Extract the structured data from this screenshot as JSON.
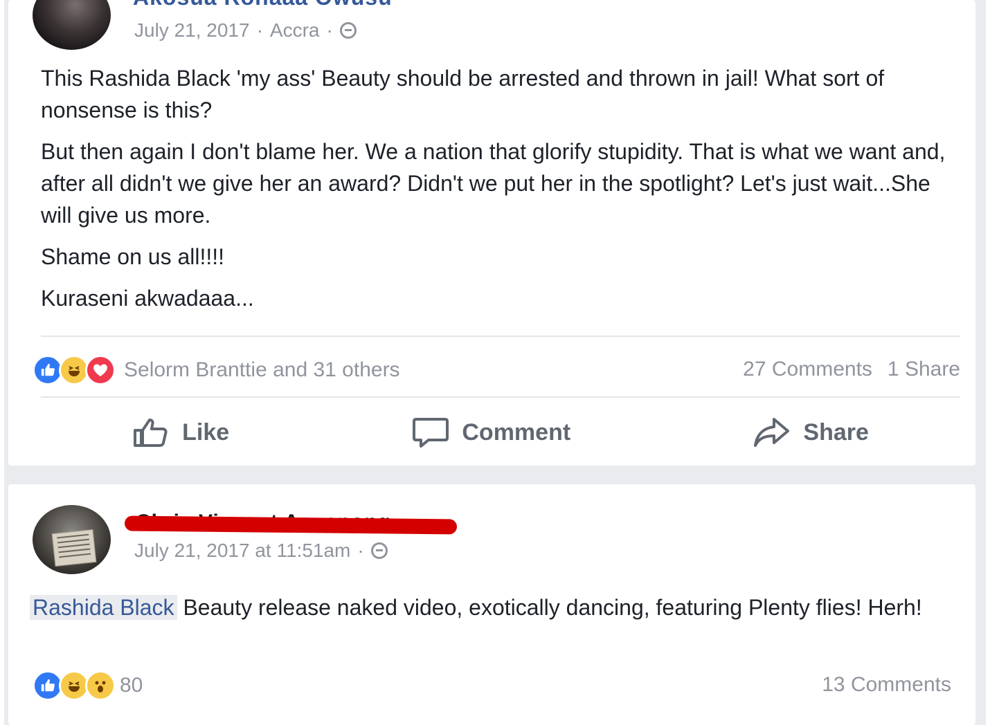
{
  "post1": {
    "author": "Akosua Ronaaa Owusu",
    "date": "July 21, 2017",
    "location": "Accra",
    "separator": "·",
    "paragraphs": [
      "This Rashida Black 'my ass' Beauty should be arrested and thrown in jail! What sort of nonsense is this?",
      "But then again I don't blame her. We a nation that glorify stupidity. That is what we want and, after all didn't we give her an award? Didn't we put her in the spotlight? Let's just wait...She will give us more.",
      "Shame on us all!!!!",
      "Kuraseni akwadaaa..."
    ],
    "reactions_summary": "Selorm Branttie and 31 others",
    "comments_count": "27 Comments",
    "shares_count": "1 Share",
    "actions": {
      "like": "Like",
      "comment": "Comment",
      "share": "Share"
    }
  },
  "post2": {
    "author": "Chris Vincent Agyapong",
    "date": "July 21, 2017 at 11:51am",
    "separator": "·",
    "mention": "Rashida Black",
    "text_after_mention": " Beauty release naked video, exotically dancing, featuring Plenty flies! Herh!",
    "reactions_count": "80",
    "comments_count": "13 Comments"
  },
  "colors": {
    "link": "#365899",
    "meta": "#90949c",
    "feed_bg": "#e9ebee",
    "redaction": "#d40000"
  },
  "icons": [
    "privacy-globe-icon",
    "like-reaction-icon",
    "haha-reaction-icon",
    "love-reaction-icon",
    "wow-reaction-icon",
    "thumbs-up-icon",
    "comment-bubble-icon",
    "share-arrow-icon"
  ]
}
